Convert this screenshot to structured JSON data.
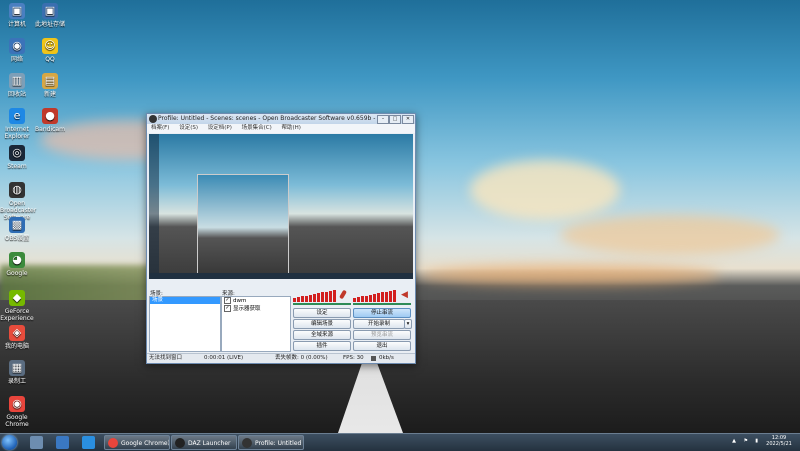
{
  "desktop": {
    "icons": [
      {
        "label": "计算机",
        "color": "#4a7fc1",
        "glyph": "▣"
      },
      {
        "label": "此地址存储",
        "color": "#3a6fb0",
        "glyph": "▣"
      },
      {
        "label": "网络",
        "color": "#3b73b9",
        "glyph": "◉"
      },
      {
        "label": "QQ",
        "color": "#f0c419",
        "glyph": "☺"
      },
      {
        "label": "回收站",
        "color": "#7d9fb8",
        "glyph": "▥"
      },
      {
        "label": "新建",
        "color": "#d6a744",
        "glyph": "▤"
      },
      {
        "label": "Internet Explorer",
        "color": "#1e88e5",
        "glyph": "e"
      },
      {
        "label": "Bandicam",
        "color": "#c0392b",
        "glyph": "●"
      },
      {
        "label": "Steam",
        "color": "#1b2838",
        "glyph": "◎"
      },
      {
        "label": "Open Broadcaster Software",
        "color": "#333333",
        "glyph": "◍"
      },
      {
        "label": "OBS设置",
        "color": "#2f6db5",
        "glyph": "▩"
      },
      {
        "label": "Google",
        "color": "#3c8b3c",
        "glyph": "◕"
      },
      {
        "label": "GeForce Experience",
        "color": "#76b900",
        "glyph": "◆"
      },
      {
        "label": "我的电脑",
        "color": "#e74c3c",
        "glyph": "◈"
      },
      {
        "label": "录制工",
        "color": "#5a6c80",
        "glyph": "▦"
      },
      {
        "label": "Google Chrome",
        "color": "#e8453c",
        "glyph": "◉"
      }
    ]
  },
  "obs": {
    "title": "Profile: Untitled - Scenes: scenes - Open Broadcaster Software v0.659b - 64bit",
    "menu": [
      "档案(F)",
      "设定(S)",
      "设定档(P)",
      "场景集合(C)",
      "帮助(H)"
    ],
    "scenes_label": "场景:",
    "scenes": [
      "场景"
    ],
    "sources_label": "来源:",
    "sources": [
      "dwm",
      "显示器获取"
    ],
    "buttons": {
      "settings": "设定",
      "stop_stream": "停止串流",
      "edit_scene": "编辑场景",
      "start_record": "开始录制",
      "global_sources": "全域来源",
      "preview_stream": "预览串流",
      "plugins": "插件",
      "exit": "退出"
    },
    "status": {
      "message": "无法找到窗口",
      "time": "0:00:01 (LIVE)",
      "dropped": "丢失帧数: 0 (0.00%)",
      "fps": "FPS: 30",
      "bitrate": "0kb/s"
    },
    "colors": {
      "meter": "#d21f1f",
      "selection": "#3399ff"
    }
  },
  "taskbar": {
    "tasks": [
      {
        "label": "Google Chrome浏览器",
        "color": "#e8453c"
      },
      {
        "label": "DAZ Launcher",
        "color": "#222222"
      },
      {
        "label": "Profile: Untitled ...",
        "color": "#333333"
      }
    ],
    "clock_time": "12:09",
    "clock_date": "2022/5/21"
  }
}
